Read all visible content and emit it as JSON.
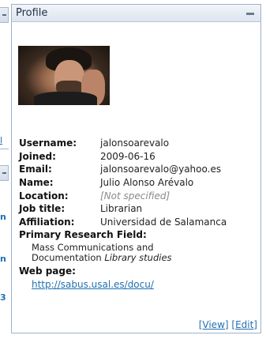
{
  "left_fragments": {
    "frag_a": "l",
    "frag_b": "n",
    "frag_c": "n",
    "frag_d": "3"
  },
  "profile": {
    "title": "Profile",
    "fields": [
      {
        "label": "Username:",
        "value": "jalonsoarevalo"
      },
      {
        "label": "Joined:",
        "value": "2009-06-16"
      },
      {
        "label": "Email:",
        "value": "jalonsoarevalo@yahoo.es"
      },
      {
        "label": "Name:",
        "value": "Julio Alonso Arévalo"
      },
      {
        "label": "Location:",
        "value": "[Not specified]"
      },
      {
        "label": "Job title:",
        "value": "Librarian"
      },
      {
        "label": "Affiliation:",
        "value": "Universidad de Salamanca"
      }
    ],
    "research_label": "Primary Research Field:",
    "research_line1": "Mass Communications and",
    "research_line2_prefix": "Documentation ",
    "research_line2_italic": "Library studies",
    "web_label": "Web page:",
    "web_url": "http://sabus.usal.es/docu/",
    "view_label": "[View]",
    "edit_label": "[Edit]"
  }
}
